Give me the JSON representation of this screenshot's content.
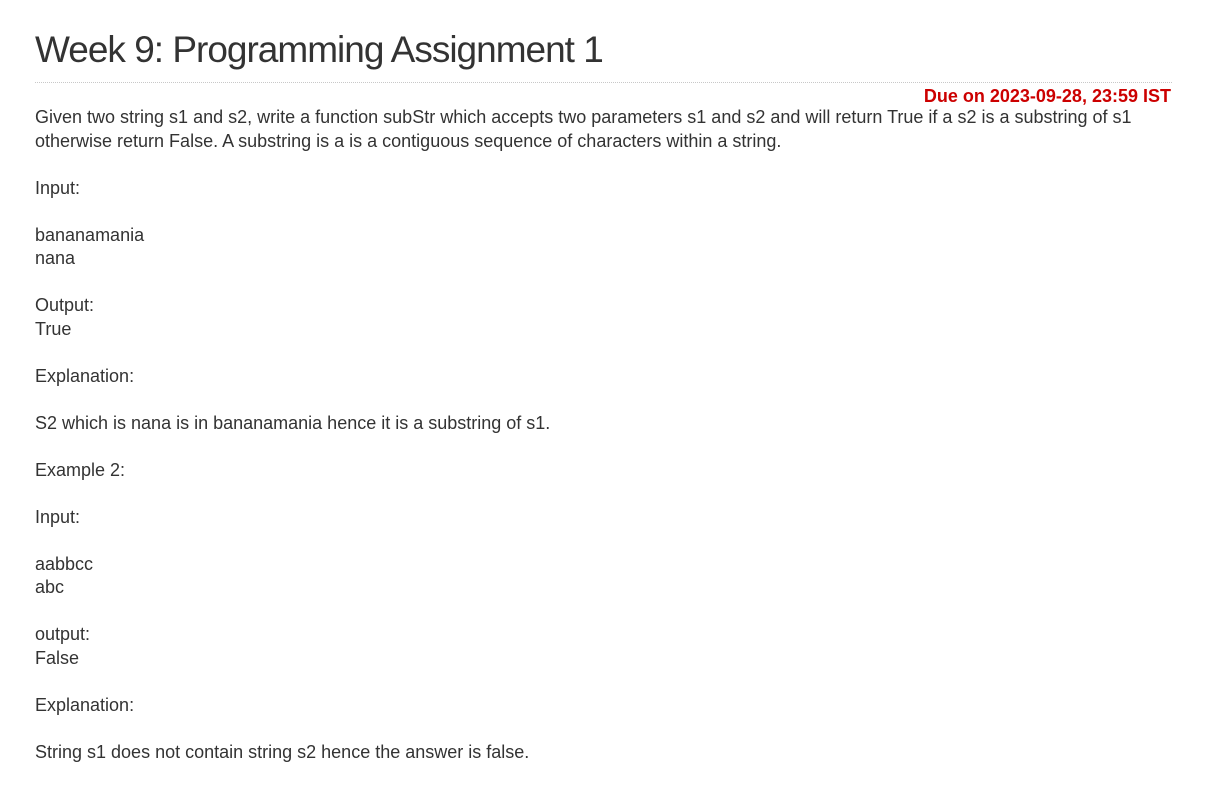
{
  "assignment": {
    "title": "Week 9: Programming Assignment 1",
    "due": "Due on 2023-09-28, 23:59 IST"
  },
  "problem": {
    "description": "Given two string s1 and s2, write a function subStr which accepts two parameters s1 and s2 and will return True if a s2 is a substring of s1 otherwise return False. A substring is a is a contiguous sequence of characters within a string.",
    "example1": {
      "input_label": "Input:",
      "input_line1": "bananamania",
      "input_line2": "nana",
      "output_label": "Output:",
      "output_value": "True",
      "explanation_label": "Explanation:",
      "explanation_text": "S2 which is nana is in bananamania hence it is a substring of s1."
    },
    "example2": {
      "heading": "Example 2:",
      "input_label": "Input:",
      "input_line1": "aabbcc",
      "input_line2": "abc",
      "output_label": "output:",
      "output_value": "False",
      "explanation_label": "Explanation:",
      "explanation_text": "String s1 does not contain string s2 hence the answer is false."
    }
  }
}
